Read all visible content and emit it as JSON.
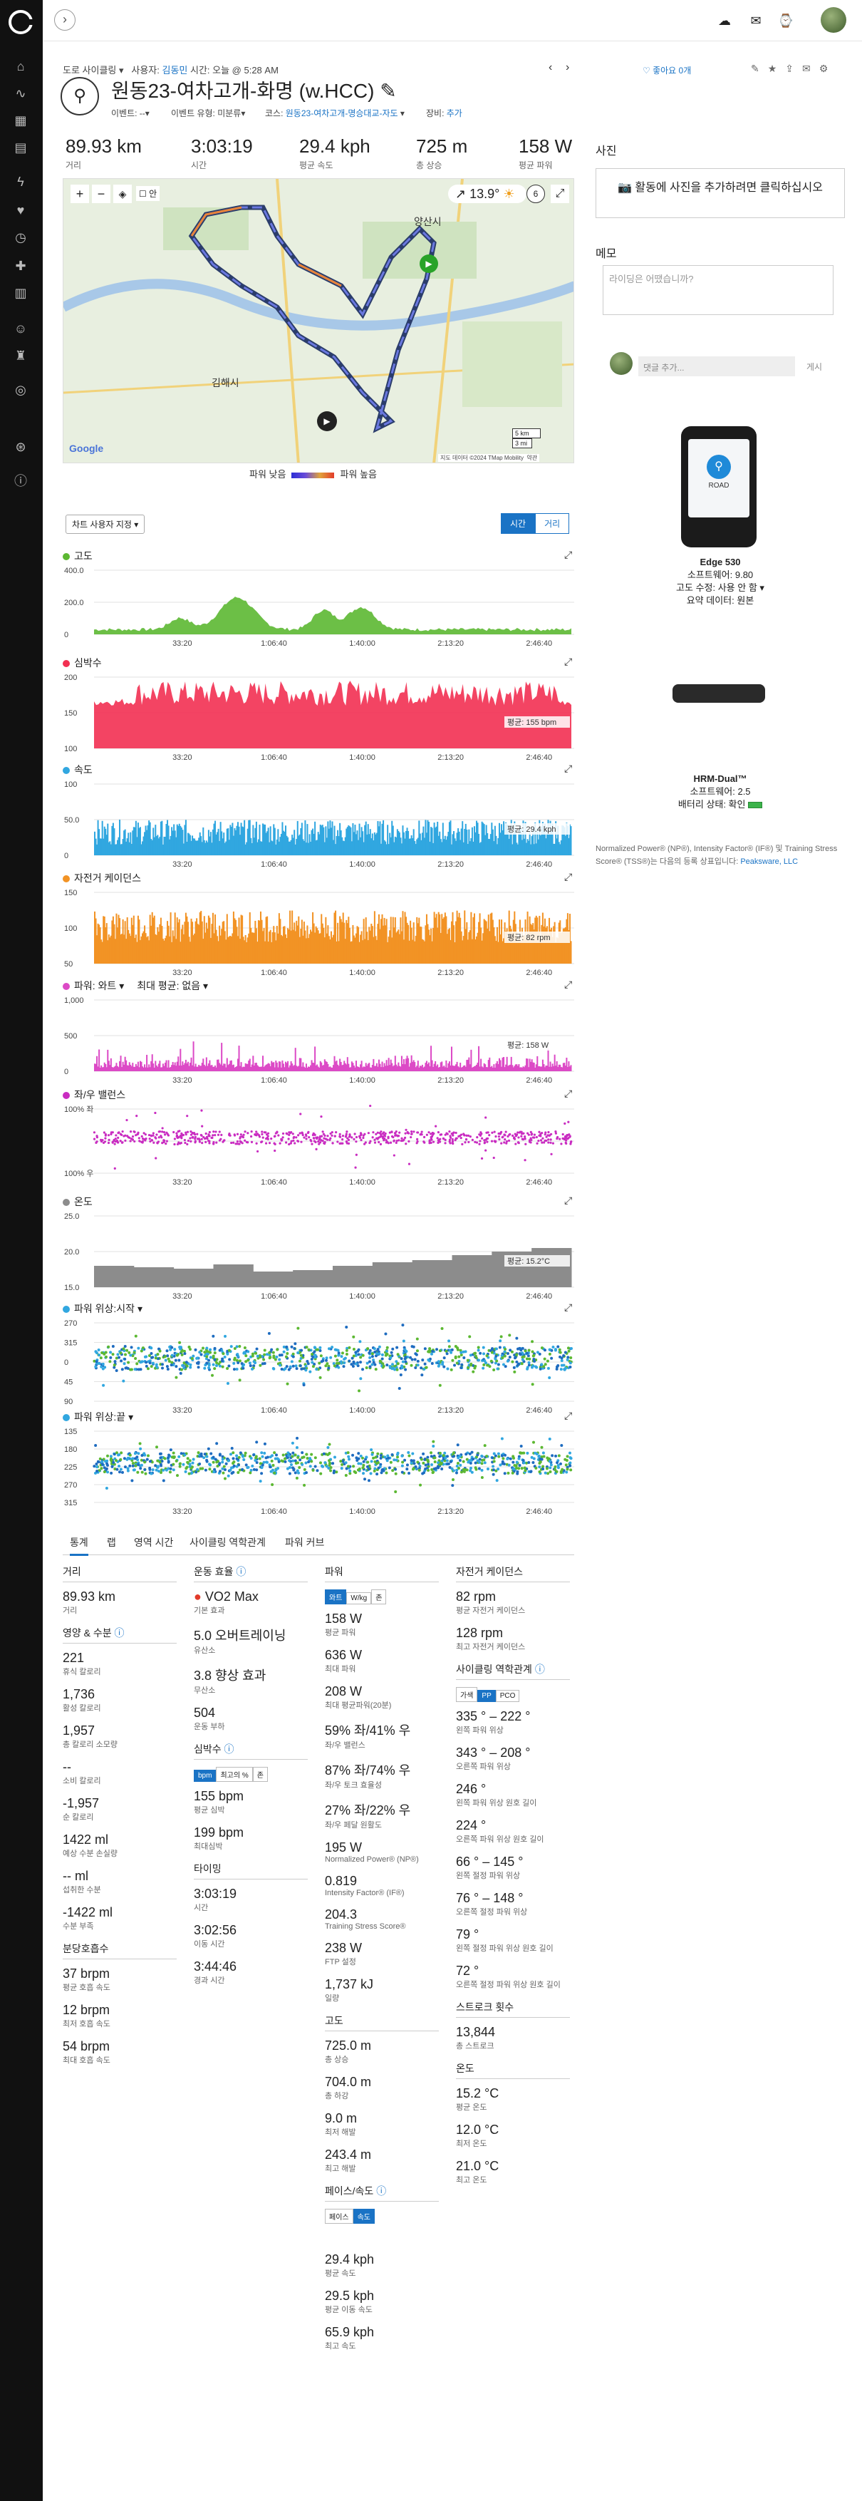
{
  "nav": {
    "icons": [
      "home-icon",
      "activity-icon",
      "calendar-icon",
      "report-icon",
      "heart-icon",
      "health-icon",
      "timer-icon",
      "chart-icon",
      "group-icon",
      "trophy-icon",
      "target-icon",
      "badge-icon",
      "info-icon"
    ]
  },
  "header": {
    "breadcrumb_type": "도로 사이클링",
    "breadcrumb_user_label": "사용자:",
    "breadcrumb_user": "김동민",
    "breadcrumb_time": "시간: 오늘 @ 5:28 AM",
    "like": "좋아요 0개"
  },
  "activity": {
    "title": "원동23-여차고개-화명 (w.HCC)",
    "event": "이벤트: --",
    "event_type": "이벤트 유형: 미분류",
    "course_label": "코스:",
    "course": "원동23-여차고개-명승대교-자도",
    "gear_label": "장비:",
    "gear": "추가"
  },
  "stats": [
    {
      "value": "89.93 km",
      "label": "거리"
    },
    {
      "value": "3:03:19",
      "label": "시간"
    },
    {
      "value": "29.4 kph",
      "label": "평균 속도"
    },
    {
      "value": "725 m",
      "label": "총 상승"
    },
    {
      "value": "158 W",
      "label": "평균 파워"
    }
  ],
  "map": {
    "temp": "13.9°",
    "wind": "6",
    "city1": "양산시",
    "city2": "김해시",
    "legend_low": "파워 낮음",
    "legend_high": "파워 높음",
    "scale1": "5 km",
    "scale2": "3 mi",
    "copyright": "지도 데이터 ©2024 TMap Mobility",
    "terms": "약관",
    "google": "Google",
    "layer": "안"
  },
  "chart_controls": {
    "dropdown": "차트 사용자 지정 ▾",
    "time": "시간",
    "distance": "거리"
  },
  "charts": {
    "elev": {
      "title": "고도",
      "y": [
        "400.0",
        "200.0",
        "0"
      ]
    },
    "hr": {
      "title": "심박수",
      "y": [
        "200",
        "150",
        "100"
      ],
      "avg": "평균: 155 bpm"
    },
    "speed": {
      "title": "속도",
      "y": [
        "100",
        "50.0",
        "0"
      ],
      "avg": "평균: 29.4 kph"
    },
    "cad": {
      "title": "자전거 케이던스",
      "y": [
        "150",
        "100",
        "50"
      ],
      "avg": "평균: 82 rpm"
    },
    "power": {
      "title": "파워: 와트 ▾",
      "extra": "최대 평균: 없음 ▾",
      "y": [
        "1,000",
        "500",
        "0"
      ],
      "avg": "평균: 158 W"
    },
    "bal": {
      "title": "좌/우 밸런스",
      "y": [
        "100% 좌",
        "",
        "100% 우"
      ]
    },
    "temp": {
      "title": "온도",
      "y": [
        "25.0",
        "20.0",
        "15.0"
      ],
      "avg": "평균: 15.2°C"
    },
    "pps": {
      "title": "파워 위상:시작 ▾",
      "y": [
        "270",
        "315",
        "0",
        "45",
        "90"
      ]
    },
    "ppe": {
      "title": "파워 위상:끝 ▾",
      "y": [
        "135",
        "180",
        "225",
        "270",
        "315"
      ]
    },
    "xt": [
      "33:20",
      "1:06:40",
      "1:40:00",
      "2:13:20",
      "2:46:40"
    ]
  },
  "tabs": [
    "통계",
    "랩",
    "영역 시간",
    "사이클링 역학관계",
    "파워 커브"
  ],
  "col1": {
    "h1": "거리",
    "dist": "89.93 km",
    "dist_l": "거리",
    "h2": "영양 & 수분",
    "items": [
      [
        "221",
        "휴식 칼로리"
      ],
      [
        "1,736",
        "활성 칼로리"
      ],
      [
        "1,957",
        "총 칼로리 소모량"
      ],
      [
        "--",
        "소비 칼로리"
      ],
      [
        "-1,957",
        "순 칼로리"
      ],
      [
        "1422 ml",
        "예상 수분 손실량"
      ],
      [
        "-- ml",
        "섭취한 수분"
      ],
      [
        "-1422 ml",
        "수분 부족"
      ]
    ],
    "h3": "분당호흡수",
    "resp": [
      [
        "37 brpm",
        "평균 호흡 속도"
      ],
      [
        "12 brpm",
        "최저 호흡 속도"
      ],
      [
        "54 brpm",
        "최대 호흡 속도"
      ]
    ]
  },
  "col2": {
    "h1": "운동 효율",
    "vo2": "VO2 Max",
    "vo2_l": "기본 효과",
    "items": [
      [
        "5.0 오버트레이닝",
        "유산소"
      ],
      [
        "3.8 향상 효과",
        "무산소"
      ],
      [
        "504",
        "운동 부하"
      ]
    ],
    "h2": "심박수",
    "hr_tabs": [
      "bpm",
      "최고의 %",
      "존"
    ],
    "hr": [
      [
        "155 bpm",
        "평균 심박"
      ],
      [
        "199 bpm",
        "최대심박"
      ]
    ],
    "h3": "타이밍",
    "timing": [
      [
        "3:03:19",
        "시간"
      ],
      [
        "3:02:56",
        "이동 시간"
      ],
      [
        "3:44:46",
        "경과 시간"
      ]
    ]
  },
  "col3": {
    "h1": "파워",
    "tabs": [
      "와트",
      "W/kg",
      "존"
    ],
    "items": [
      [
        "158 W",
        "평균 파워"
      ],
      [
        "636 W",
        "최대 파워"
      ],
      [
        "208 W",
        "최대 평균파워(20분)"
      ],
      [
        "59% 좌/41% 우",
        "좌/우 밸런스"
      ],
      [
        "87% 좌/74% 우",
        "좌/우 토크 효율성"
      ],
      [
        "27% 좌/22% 우",
        "좌/우 페달 원활도"
      ],
      [
        "195 W",
        "Normalized Power® (NP®)"
      ],
      [
        "0.819",
        "Intensity Factor® (IF®)"
      ],
      [
        "204.3",
        "Training Stress Score®"
      ],
      [
        "238 W",
        "FTP 설정"
      ],
      [
        "1,737 kJ",
        "일량"
      ]
    ],
    "h2": "고도",
    "elev": [
      [
        "725.0 m",
        "총 상승"
      ],
      [
        "704.0 m",
        "총 하강"
      ],
      [
        "9.0 m",
        "최저 해발"
      ],
      [
        "243.4 m",
        "최고 해발"
      ]
    ],
    "h3": "페이스/속도",
    "ps_tabs": [
      "페이스",
      "속도"
    ],
    "speed": [
      [
        "29.4 kph",
        "평균 속도"
      ],
      [
        "29.5 kph",
        "평균 이동 속도"
      ],
      [
        "65.9 kph",
        "최고 속도"
      ]
    ]
  },
  "col4": {
    "h1": "자전거 케이던스",
    "cad": [
      [
        "82 rpm",
        "평균 자전거 케이던스"
      ],
      [
        "128 rpm",
        "최고 자전거 케이던스"
      ]
    ],
    "h2": "사이클링 역학관계",
    "tabs": [
      "가색",
      "PP",
      "PCO"
    ],
    "dyn": [
      [
        "335 ° – 222 °",
        "왼쪽 파워 위상"
      ],
      [
        "343 ° – 208 °",
        "오른쪽 파워 위상"
      ],
      [
        "246 °",
        "왼쪽 파워 위상 원호 길이"
      ],
      [
        "224 °",
        "오른쪽 파워 위상 원호 길이"
      ],
      [
        "66 ° – 145 °",
        "왼쪽 절정 파워 위상"
      ],
      [
        "76 ° – 148 °",
        "오른쪽 절정 파워 위상"
      ],
      [
        "79 °",
        "왼쪽 절정 파워 위상 원호 길이"
      ],
      [
        "72 °",
        "오른쪽 절정 파워 위상 원호 길이"
      ]
    ],
    "h3": "스트로크 횟수",
    "strokes": "13,844",
    "strokes_l": "총 스트로크",
    "h4": "온도",
    "temp": [
      [
        "15.2 °C",
        "평균 온도"
      ],
      [
        "12.0 °C",
        "최저 온도"
      ],
      [
        "21.0 °C",
        "최고 온도"
      ]
    ]
  },
  "right": {
    "photos": "사진",
    "photo_btn": "활동에 사진을 추가하려면 클릭하십시오",
    "memo": "메모",
    "memo_ph": "라이딩은 어땠습니까?",
    "comment_ph": "댓글 추가...",
    "post": "게시",
    "device1": "Edge 530",
    "device1_sw": "소프트웨어: 9.80",
    "device1_el": "고도 수정: 사용 안 함 ▾",
    "device1_data": "요약 데이터: 원본",
    "device_screen": "ROAD",
    "device2": "HRM-Dual™",
    "device2_sw": "소프트웨어: 2.5",
    "device2_bat": "배터리 상태: 확인",
    "trademark": "Normalized Power® (NP®), Intensity Factor® (IF®) 및 Training Stress Score® (TSS®)는 다음의 등록 상표입니다:",
    "trademark_link": "Peaksware, LLC"
  },
  "colors": {
    "elev": "#5cb832",
    "hr": "#f23052",
    "speed": "#31a7e0",
    "cad": "#f29325",
    "power": "#dc4ac6",
    "bal": "#c92cc1",
    "temp": "#8c8c8c",
    "accent": "#1a73c5"
  }
}
